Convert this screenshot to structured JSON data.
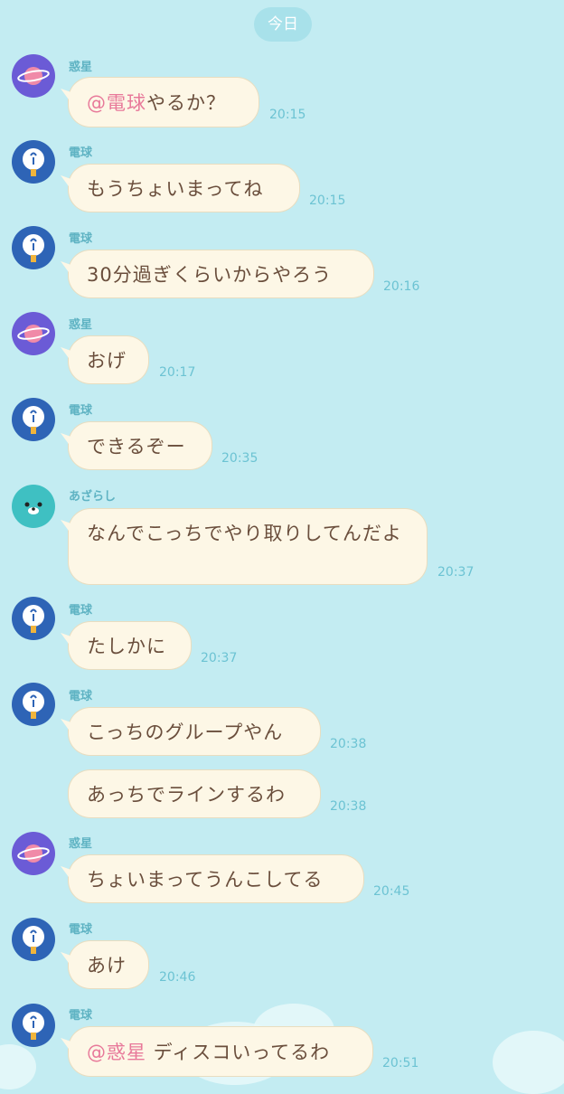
{
  "date_label": "今日",
  "names": {
    "wakusei": "惑星",
    "denkyu": "電球",
    "azarashi": "あざらし"
  },
  "messages": [
    {
      "sender": "惑星",
      "mention": "@電球",
      "text": "やるか？",
      "time": "20:15"
    },
    {
      "sender": "電球",
      "text": "もうちょいまってね",
      "time": "20:15"
    },
    {
      "sender": "電球",
      "text": "30分過ぎくらいからやろう",
      "time": "20:16"
    },
    {
      "sender": "惑星",
      "text": "おげ",
      "time": "20:17"
    },
    {
      "sender": "電球",
      "text": "できるぞー",
      "time": "20:35"
    },
    {
      "sender": "あざらし",
      "text": "なんでこっちでやり取りしてんだよ",
      "time": "20:37"
    },
    {
      "sender": "電球",
      "text": "たしかに",
      "time": "20:37"
    },
    {
      "sender": "電球",
      "text": "こっちのグループやん",
      "time": "20:38"
    },
    {
      "sender": "",
      "text": "あっちでラインするわ",
      "time": "20:38"
    },
    {
      "sender": "惑星",
      "text": "ちょいまってうんこしてる",
      "time": "20:45"
    },
    {
      "sender": "電球",
      "text": "あけ",
      "time": "20:46"
    },
    {
      "sender": "電球",
      "mention": "@惑星",
      "text": " ディスコいってるわ",
      "time": "20:51"
    }
  ],
  "colors": {
    "background": "#c3ecf2",
    "bubble": "#fdf7e6",
    "text": "#6a4e3c",
    "mention": "#e8799a",
    "time": "#6cc3d3",
    "planet_avatar": "#6b5bd6",
    "bulb_avatar": "#2e64b6",
    "seal_avatar": "#3fc0c2"
  },
  "icons": [
    "planet-avatar-icon",
    "light-bulb-avatar-icon",
    "seal-avatar-icon"
  ]
}
